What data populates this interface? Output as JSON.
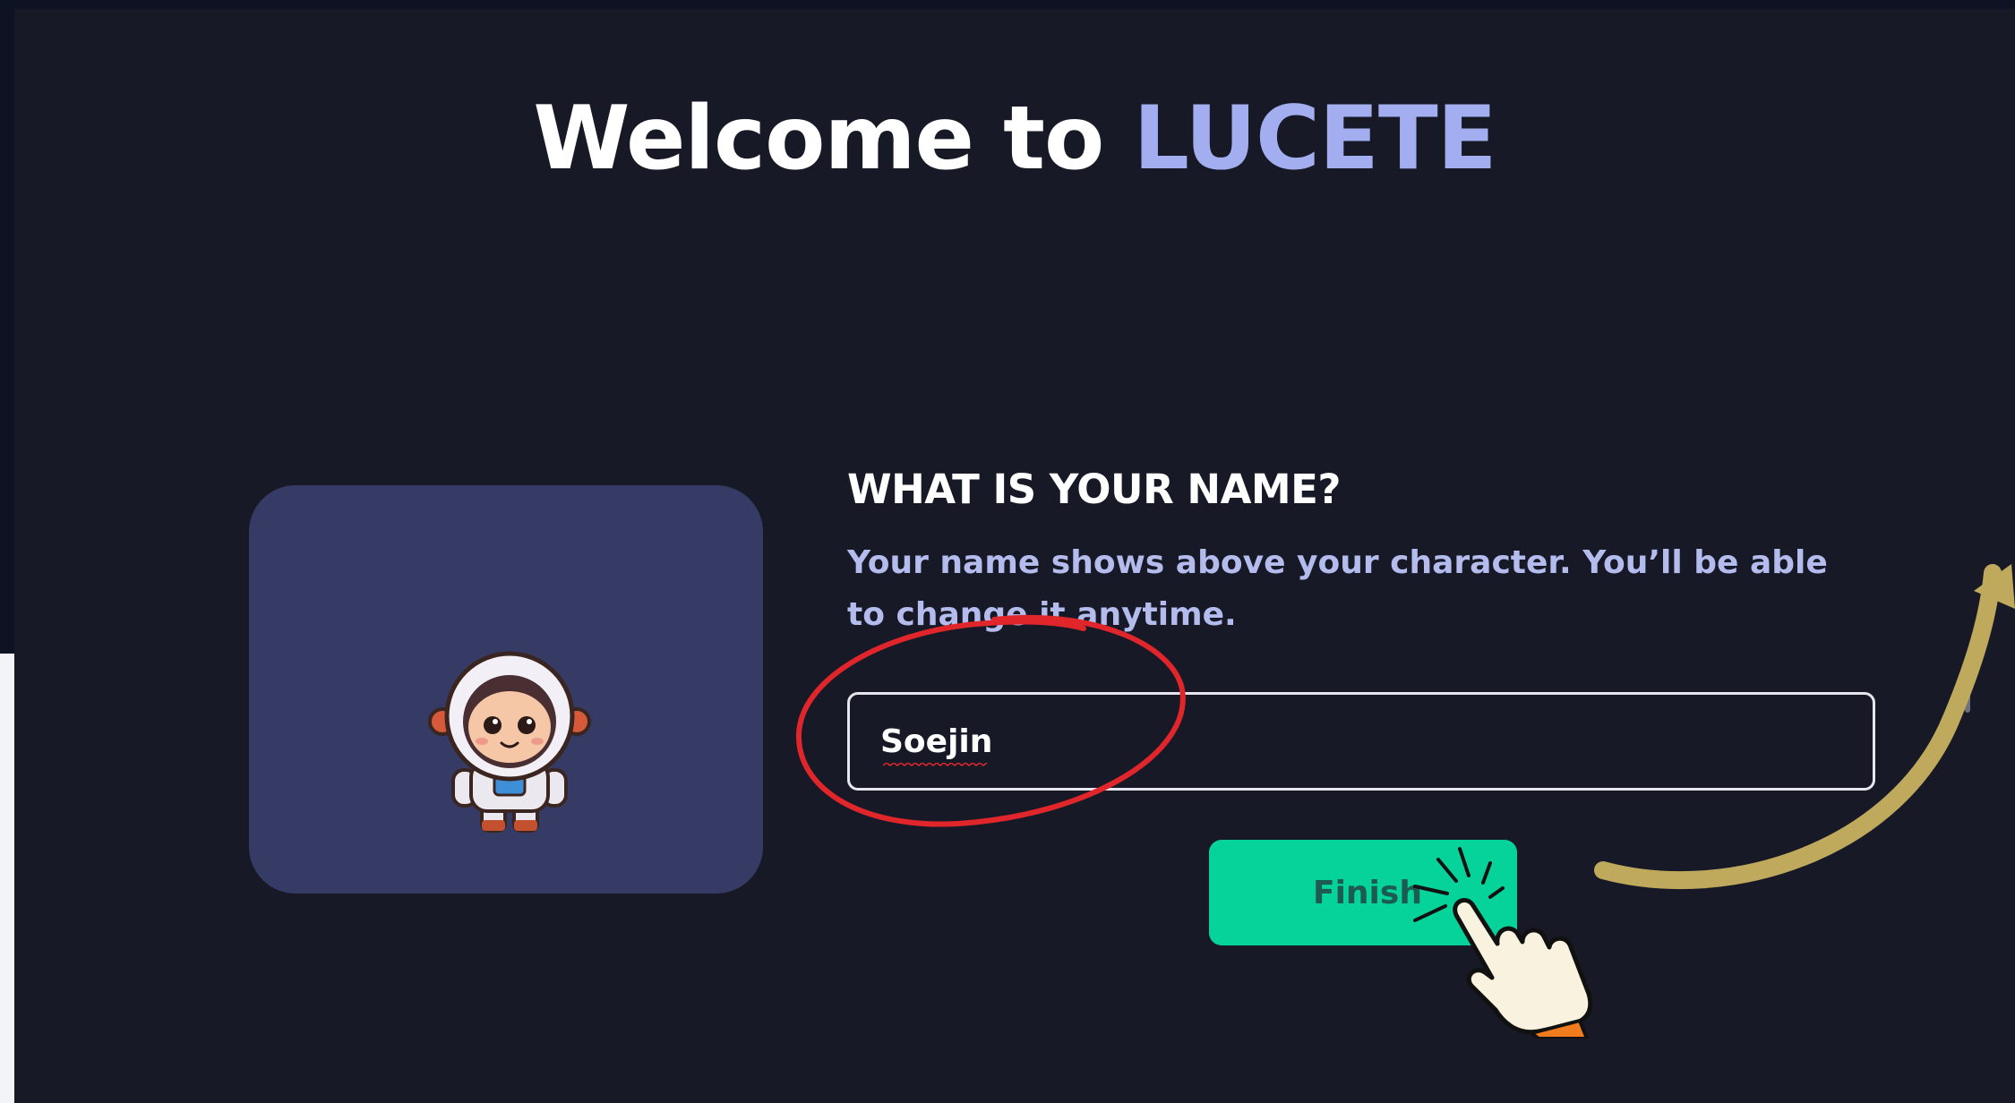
{
  "header": {
    "title_prefix": "Welcome to",
    "title_brand": "LUCETE"
  },
  "name_step": {
    "question": "WHAT IS YOUR NAME?",
    "hint": "Your name shows above your character. You’ll be able to change it anytime.",
    "input_value": "Soejin",
    "finish_label": "Finish"
  },
  "avatar": {
    "character": "astronaut-avatar"
  },
  "colors": {
    "background": "#171a26",
    "brand_accent": "#a3aef0",
    "hint_text": "#b3bcec",
    "avatar_card": "#363b66",
    "finish_button": "#05d39a",
    "annotation_circle": "#e0262b",
    "annotation_arrow": "#bfa95c"
  },
  "annotations": {
    "circle": "red-circle-highlight",
    "arrow": "curved-arrow",
    "pointer": "hand-click-icon"
  }
}
